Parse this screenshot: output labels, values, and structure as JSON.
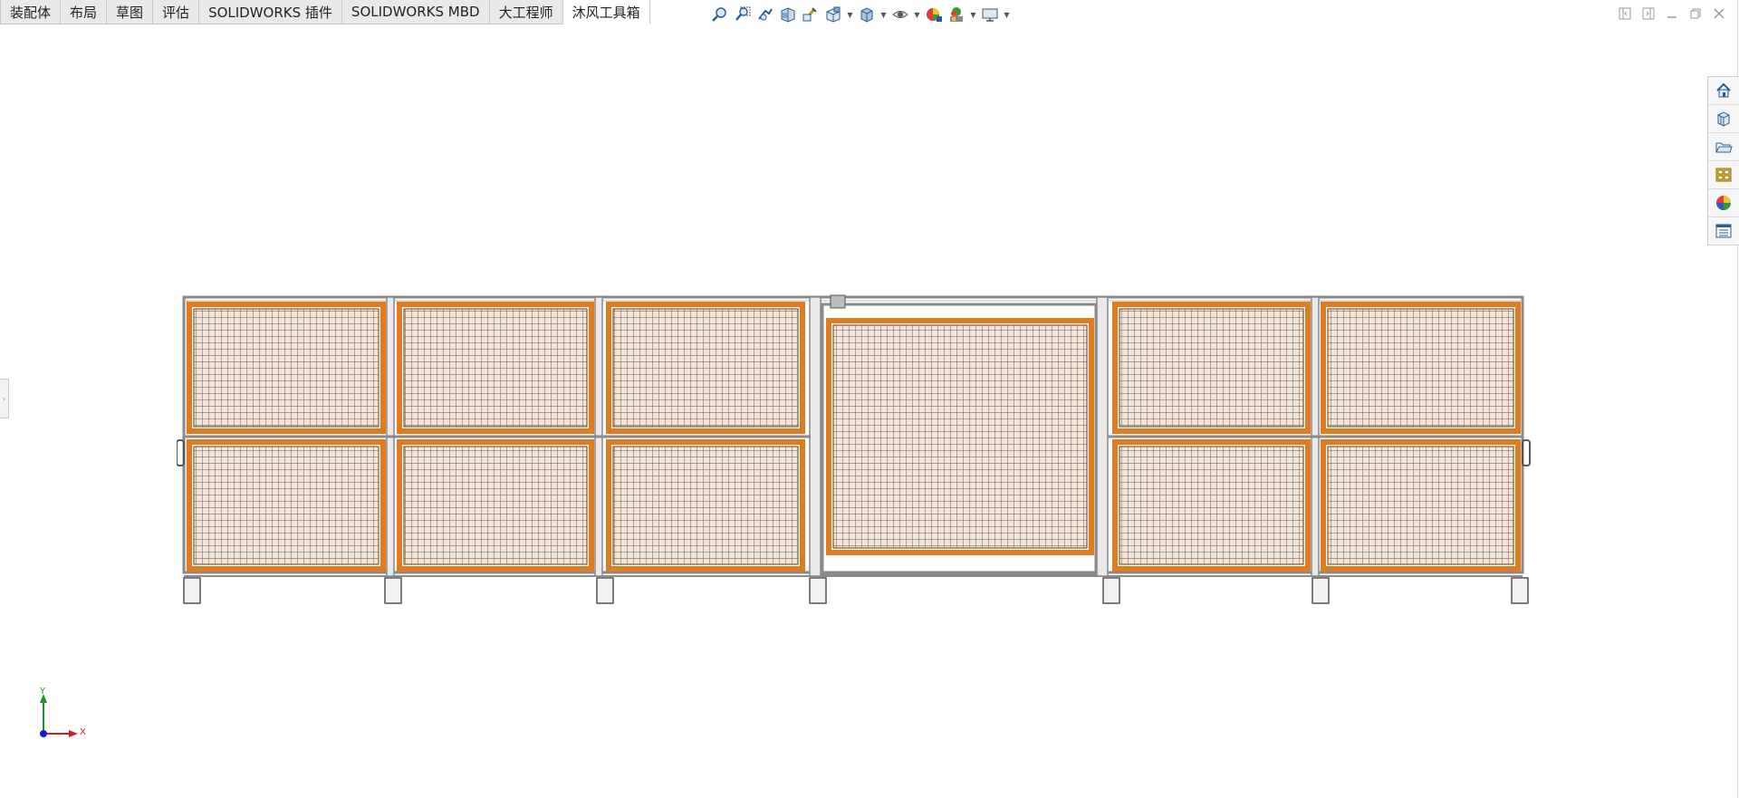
{
  "tabs": [
    {
      "label": "装配体",
      "active": false
    },
    {
      "label": "布局",
      "active": false
    },
    {
      "label": "草图",
      "active": false
    },
    {
      "label": "评估",
      "active": false
    },
    {
      "label": "SOLIDWORKS 插件",
      "active": false
    },
    {
      "label": "SOLIDWORKS MBD",
      "active": false
    },
    {
      "label": "大工程师",
      "active": false
    },
    {
      "label": "沐风工具箱",
      "active": true
    }
  ],
  "headsup_icons": [
    "zoom-to-fit-icon",
    "zoom-to-area-icon",
    "previous-view-icon",
    "section-view-icon",
    "dynamic-annotation-icon",
    "view-orientation-icon",
    "display-style-icon",
    "hide-show-items-icon",
    "edit-appearance-icon",
    "apply-scene-icon",
    "view-settings-icon"
  ],
  "taskpane_icons": [
    "home-icon",
    "design-library-icon",
    "file-explorer-icon",
    "view-palette-icon",
    "appearances-icon",
    "custom-properties-icon"
  ],
  "triad": {
    "x_label": "X",
    "y_label": "Y"
  },
  "colors": {
    "frame_orange": "#e07b1f",
    "frame_gray": "#8a8a8a",
    "mesh_fill": "#f3e6d8",
    "axis_x": "#d42020",
    "axis_y": "#1a9a1a",
    "axis_z": "#1a1ad4"
  }
}
